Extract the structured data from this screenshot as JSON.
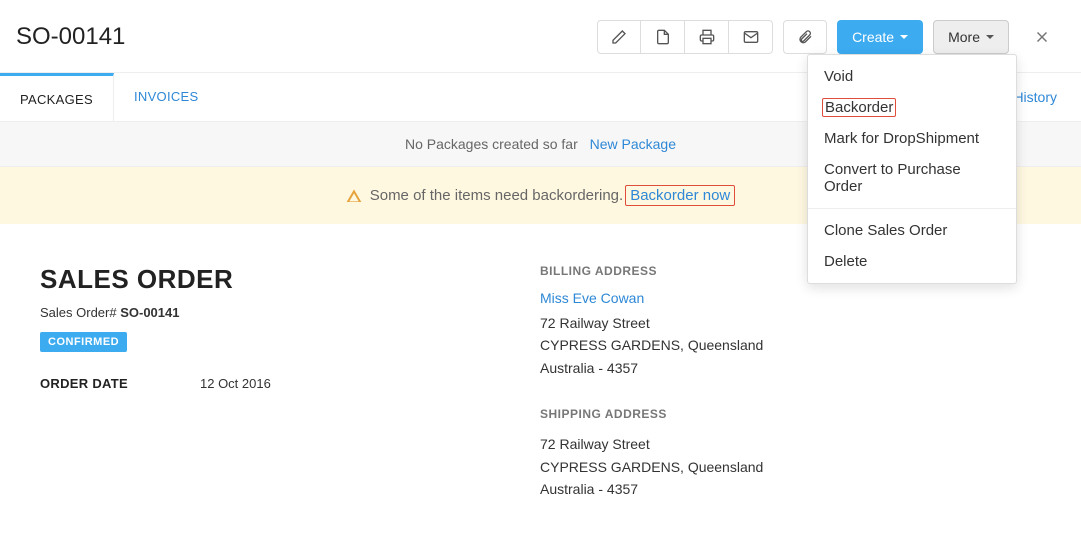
{
  "header": {
    "title": "SO-00141",
    "create_label": "Create",
    "more_label": "More"
  },
  "tabs": {
    "packages": "PACKAGES",
    "invoices": "INVOICES",
    "history": "History"
  },
  "subheader": {
    "text": "No Packages created so far",
    "link": "New Package"
  },
  "alert": {
    "text": "Some of the items need backordering.",
    "link": "Backorder now"
  },
  "dropdown": {
    "void": "Void",
    "backorder": "Backorder",
    "drop": "Mark for DropShipment",
    "convert": "Convert to Purchase Order",
    "clone": "Clone Sales Order",
    "delete": "Delete"
  },
  "doc": {
    "title": "SALES ORDER",
    "so_label": "Sales Order#",
    "so_number": "SO-00141",
    "status": "CONFIRMED",
    "order_date_label": "ORDER DATE",
    "order_date": "12 Oct 2016"
  },
  "billing": {
    "label": "BILLING ADDRESS",
    "name": "Miss Eve Cowan",
    "line1": "72 Railway Street",
    "line2": "CYPRESS GARDENS, Queensland",
    "line3": "Australia - 4357"
  },
  "shipping": {
    "label": "SHIPPING ADDRESS",
    "line1": "72 Railway Street",
    "line2": "CYPRESS GARDENS, Queensland",
    "line3": "Australia - 4357"
  }
}
